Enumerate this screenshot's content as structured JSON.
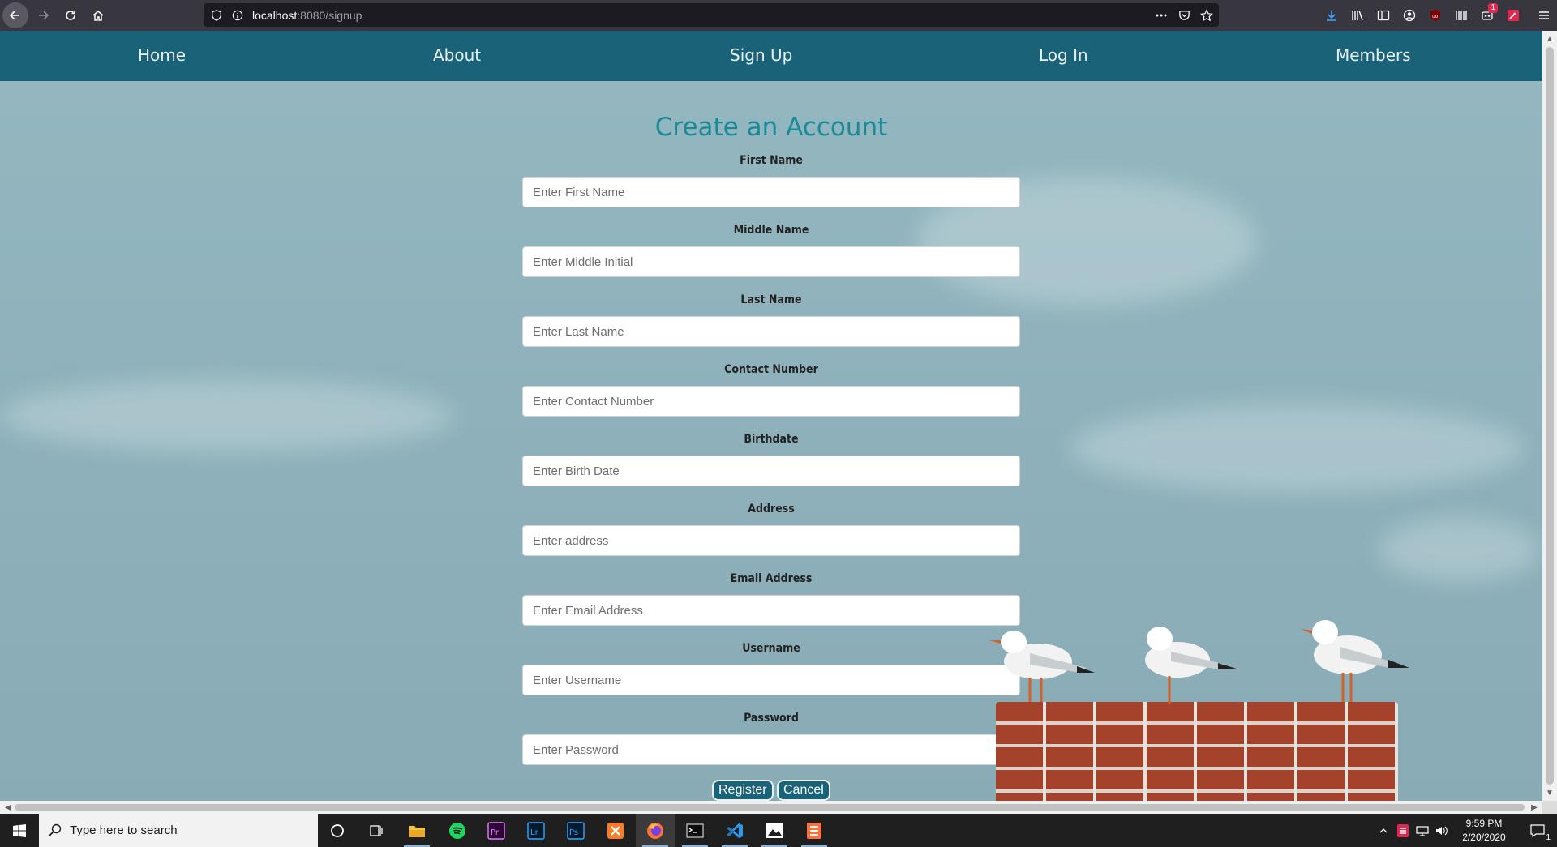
{
  "browser": {
    "url_host": "localhost",
    "url_path": ":8080/signup",
    "download_badge": "1"
  },
  "nav": {
    "home": "Home",
    "about": "About",
    "signup": "Sign Up",
    "login": "Log In",
    "members": "Members"
  },
  "form": {
    "title": "Create an Account",
    "fields": [
      {
        "label": "First Name",
        "placeholder": "Enter First Name"
      },
      {
        "label": "Middle Name",
        "placeholder": "Enter Middle Initial"
      },
      {
        "label": "Last Name",
        "placeholder": "Enter Last Name"
      },
      {
        "label": "Contact Number",
        "placeholder": "Enter Contact Number"
      },
      {
        "label": "Birthdate",
        "placeholder": "Enter Birth Date"
      },
      {
        "label": "Address",
        "placeholder": "Enter address"
      },
      {
        "label": "Email Address",
        "placeholder": "Enter Email Address"
      },
      {
        "label": "Username",
        "placeholder": "Enter Username"
      },
      {
        "label": "Password",
        "placeholder": "Enter Password"
      }
    ],
    "register_label": "Register",
    "cancel_label": "Cancel"
  },
  "taskbar": {
    "search_placeholder": "Type here to search",
    "time": "9:59 PM",
    "date": "2/20/2020",
    "notification_count": "1"
  },
  "colors": {
    "nav_bg": "#1a6278",
    "title": "#1b8a96",
    "page_bg": "#8fb2bc"
  }
}
